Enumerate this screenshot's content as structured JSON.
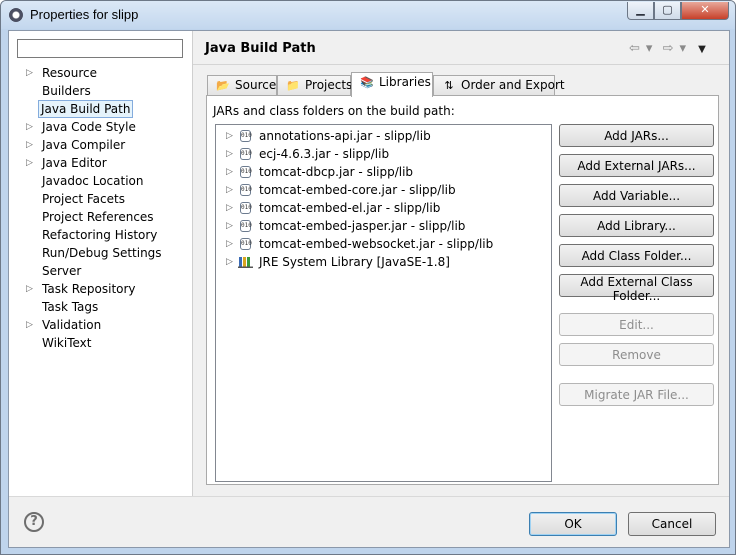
{
  "window": {
    "title": "Properties for slipp",
    "min_glyph": "▁",
    "max_glyph": "▢",
    "close_glyph": "✕"
  },
  "sidebar": {
    "filter_value": "",
    "items": [
      {
        "label": "Resource",
        "expandable": true
      },
      {
        "label": "Builders",
        "expandable": false
      },
      {
        "label": "Java Build Path",
        "expandable": false,
        "selected": true
      },
      {
        "label": "Java Code Style",
        "expandable": true
      },
      {
        "label": "Java Compiler",
        "expandable": true
      },
      {
        "label": "Java Editor",
        "expandable": true
      },
      {
        "label": "Javadoc Location",
        "expandable": false
      },
      {
        "label": "Project Facets",
        "expandable": false
      },
      {
        "label": "Project References",
        "expandable": false
      },
      {
        "label": "Refactoring History",
        "expandable": false
      },
      {
        "label": "Run/Debug Settings",
        "expandable": false
      },
      {
        "label": "Server",
        "expandable": false
      },
      {
        "label": "Task Repository",
        "expandable": true
      },
      {
        "label": "Task Tags",
        "expandable": false
      },
      {
        "label": "Validation",
        "expandable": true
      },
      {
        "label": "WikiText",
        "expandable": false
      }
    ]
  },
  "page": {
    "title": "Java Build Path",
    "nav": {
      "back": "⇦",
      "back_menu": "▾",
      "forward": "⇨",
      "forward_menu": "▾",
      "view_menu": "▼"
    }
  },
  "tabs": [
    {
      "label": "Source",
      "icon": "source-folder-icon",
      "active": false
    },
    {
      "label": "Projects",
      "icon": "project-folder-icon",
      "active": false
    },
    {
      "label": "Libraries",
      "icon": "library-icon",
      "active": true
    },
    {
      "label": "Order and Export",
      "icon": "order-export-icon",
      "active": false
    }
  ],
  "libraries": {
    "label": "JARs and class folders on the build path:",
    "jar_icon_text": "010",
    "items": [
      {
        "text": "annotations-api.jar - slipp/lib",
        "kind": "jar"
      },
      {
        "text": "ecj-4.6.3.jar - slipp/lib",
        "kind": "jar"
      },
      {
        "text": "tomcat-dbcp.jar - slipp/lib",
        "kind": "jar"
      },
      {
        "text": "tomcat-embed-core.jar - slipp/lib",
        "kind": "jar"
      },
      {
        "text": "tomcat-embed-el.jar - slipp/lib",
        "kind": "jar"
      },
      {
        "text": "tomcat-embed-jasper.jar - slipp/lib",
        "kind": "jar"
      },
      {
        "text": "tomcat-embed-websocket.jar - slipp/lib",
        "kind": "jar"
      },
      {
        "text": "JRE System Library [JavaSE-1.8]",
        "kind": "jre"
      }
    ],
    "buttons": [
      {
        "label": "Add JARs...",
        "enabled": true
      },
      {
        "label": "Add External JARs...",
        "enabled": true
      },
      {
        "label": "Add Variable...",
        "enabled": true
      },
      {
        "label": "Add Library...",
        "enabled": true
      },
      {
        "label": "Add Class Folder...",
        "enabled": true
      },
      {
        "label": "Add External Class Folder...",
        "enabled": true
      },
      {
        "label": "Edit...",
        "enabled": false
      },
      {
        "label": "Remove",
        "enabled": false
      },
      {
        "label": "Migrate JAR File...",
        "enabled": false
      }
    ]
  },
  "footer": {
    "help": "?",
    "ok": "OK",
    "cancel": "Cancel"
  },
  "colors": {
    "window_frame": "#bfd4ec",
    "selection_bg": "#e5f3fb",
    "selection_border": "#84acdd",
    "close_button": "#c7402a"
  }
}
